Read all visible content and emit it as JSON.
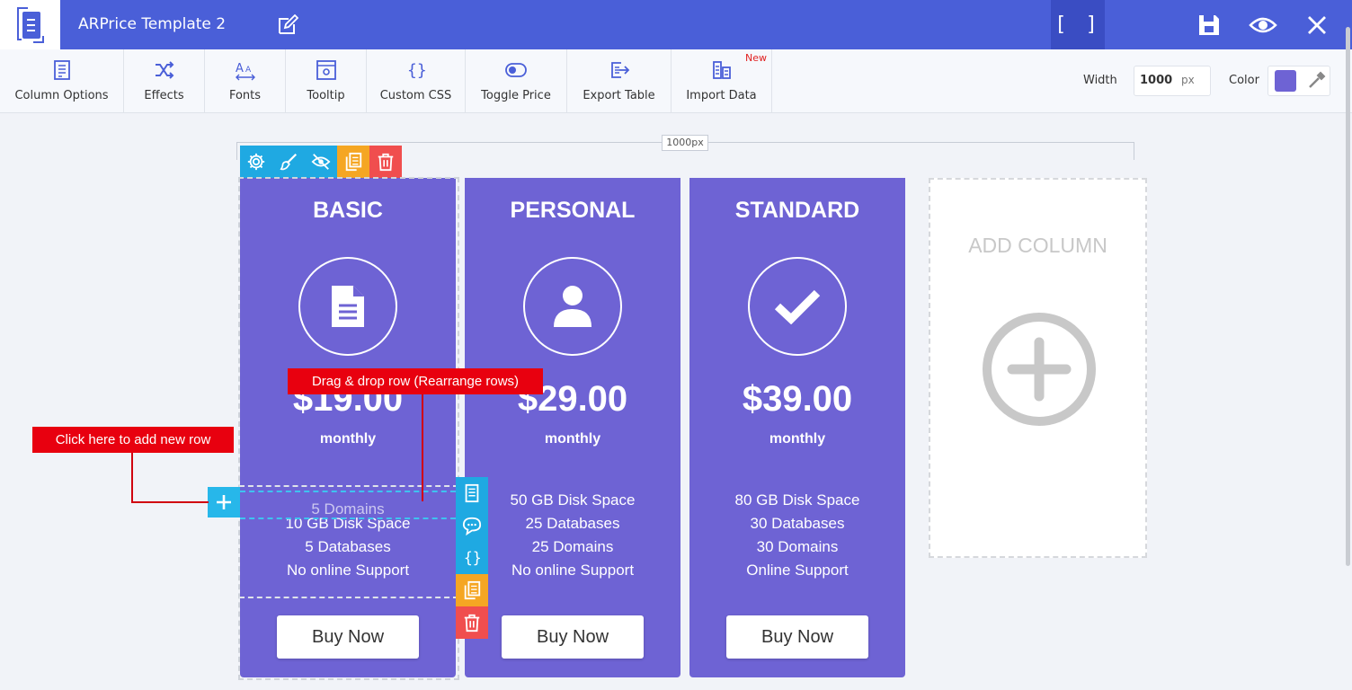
{
  "header": {
    "title": "ARPrice Template 2",
    "fullscreen_label": "[ ]",
    "bg_color": "#4a5fd8"
  },
  "toolbar": {
    "items": [
      {
        "label": "Column Options",
        "icon": "column-options-icon"
      },
      {
        "label": "Effects",
        "icon": "shuffle-icon"
      },
      {
        "label": "Fonts",
        "icon": "fonts-icon"
      },
      {
        "label": "Tooltip",
        "icon": "tooltip-icon"
      },
      {
        "label": "Custom CSS",
        "icon": "braces-icon"
      },
      {
        "label": "Toggle Price",
        "icon": "toggle-icon"
      },
      {
        "label": "Export Table",
        "icon": "export-icon"
      },
      {
        "label": "Import Data",
        "icon": "import-icon"
      }
    ],
    "new_badge": "New",
    "width_label": "Width",
    "width_value": "1000",
    "width_unit": "px",
    "color_label": "Color",
    "color_value": "#6e63d4"
  },
  "canvas": {
    "ruler_label": "1000px",
    "add_column_label": "ADD COLUMN"
  },
  "columns": [
    {
      "title": "BASIC",
      "icon": "document-icon",
      "price": "$19.00",
      "period": "monthly",
      "features": [
        "5 Domains",
        "10 GB Disk Space",
        "5 Databases",
        "No online Support"
      ],
      "button": "Buy Now"
    },
    {
      "title": "PERSONAL",
      "icon": "user-icon",
      "price": "$29.00",
      "period": "monthly",
      "features": [
        "50 GB Disk Space",
        "25 Databases",
        "25 Domains",
        "No online Support"
      ],
      "button": "Buy Now"
    },
    {
      "title": "STANDARD",
      "icon": "checkmark-icon",
      "price": "$39.00",
      "period": "monthly",
      "features": [
        "80 GB Disk Space",
        "30 Databases",
        "30 Domains",
        "Online Support"
      ],
      "button": "Buy Now"
    }
  ],
  "annotations": {
    "drag_drop": "Drag & drop row (Rearrange rows)",
    "add_row": "Click here to add new row"
  }
}
